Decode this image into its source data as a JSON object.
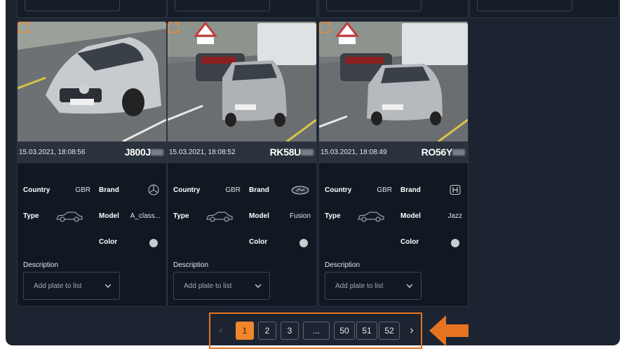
{
  "cards": [
    {
      "timestamp": "15.03.2021, 18:08:56",
      "plate": "J800J",
      "country_label": "Country",
      "country_value": "GBR",
      "brand_label": "Brand",
      "brand_icon": "mercedes-logo-icon",
      "type_label": "Type",
      "type_icon": "car-icon",
      "model_label": "Model",
      "model_value": "A_class...",
      "color_label": "Color",
      "color_swatch": "#c9ccd0",
      "description_label": "Description",
      "select_placeholder": "Add plate to list"
    },
    {
      "timestamp": "15.03.2021, 18:08:52",
      "plate": "RK58U",
      "country_label": "Country",
      "country_value": "GBR",
      "brand_label": "Brand",
      "brand_icon": "ford-logo-icon",
      "type_label": "Type",
      "type_icon": "car-icon",
      "model_label": "Model",
      "model_value": "Fusion",
      "color_label": "Color",
      "color_swatch": "#c9ccd0",
      "description_label": "Description",
      "select_placeholder": "Add plate to list"
    },
    {
      "timestamp": "15.03.2021, 18:08:49",
      "plate": "RO56Y",
      "country_label": "Country",
      "country_value": "GBR",
      "brand_label": "Brand",
      "brand_icon": "honda-logo-icon",
      "type_label": "Type",
      "type_icon": "car-icon",
      "model_label": "Model",
      "model_value": "Jazz",
      "color_label": "Color",
      "color_swatch": "#c9ccd0",
      "description_label": "Description",
      "select_placeholder": "Add plate to list"
    }
  ],
  "pagination": {
    "prev_icon": "chevron-left-icon",
    "next_icon": "chevron-right-icon",
    "pages": [
      "1",
      "2",
      "3",
      "...",
      "50",
      "51",
      "52"
    ],
    "active_page": "1"
  },
  "colors": {
    "accent": "#f0872a",
    "highlight_border": "#e57320",
    "panel_bg": "#1c2431",
    "card_bg": "#101822"
  }
}
